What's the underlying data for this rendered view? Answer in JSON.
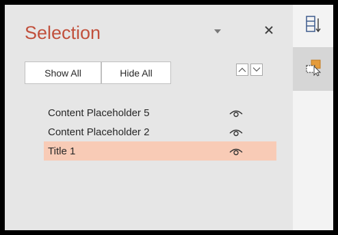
{
  "pane": {
    "title": "Selection",
    "show_all_label": "Show All",
    "hide_all_label": "Hide All",
    "icons": {
      "dropdown": "chevron-down-icon",
      "close": "close-icon",
      "bring_forward": "chevron-up-icon",
      "send_backward": "chevron-down-icon",
      "visibility": "eye-icon"
    },
    "items": [
      {
        "label": "Content Placeholder 5",
        "selected": false
      },
      {
        "label": "Content Placeholder 2",
        "selected": false
      },
      {
        "label": "Title 1",
        "selected": true
      }
    ]
  },
  "sidebar": {
    "buttons": [
      {
        "icon": "reorder-document-icon"
      },
      {
        "icon": "selection-pane-icon",
        "active": true
      }
    ]
  },
  "colors": {
    "title": "#c1503c",
    "pane_bg": "#e6e6e6",
    "selected_row": "#f8cbb6",
    "sidebar_bg": "#f3f3f3",
    "sidebar_active": "#d6d6d6",
    "icon_accent": "#e49b3a",
    "frame": "#000000"
  }
}
